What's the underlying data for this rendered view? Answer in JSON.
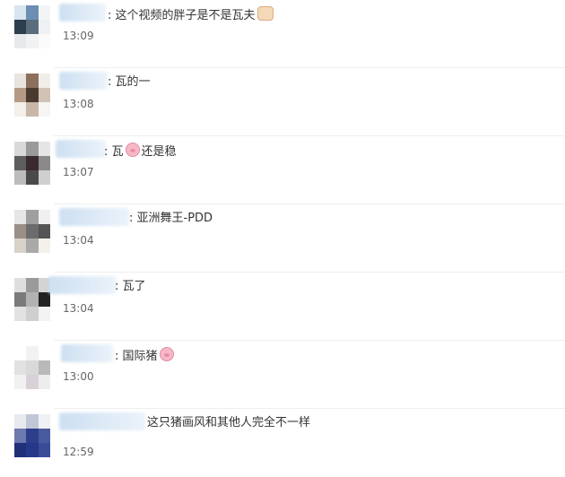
{
  "comments": [
    {
      "text": "这个视频的胖子是不是瓦夫",
      "time": "13:09",
      "emoji": "fist-emoji"
    },
    {
      "text": "瓦的一",
      "time": "13:08"
    },
    {
      "text_before": "瓦",
      "text_after": "还是稳",
      "time": "13:07",
      "emoji": "pig-emoji"
    },
    {
      "text": "亚洲舞王-PDD",
      "time": "13:04"
    },
    {
      "text": "瓦了",
      "time": "13:04"
    },
    {
      "text": "国际猪",
      "time": "13:00",
      "emoji": "pig-emoji"
    },
    {
      "text": "这只猪画风和其他人完全不一样",
      "time": "12:59"
    }
  ],
  "colors": {
    "separator": "#eeeeee",
    "name_blur": "#c8dcf0",
    "time": "#666666",
    "text": "#333333"
  }
}
